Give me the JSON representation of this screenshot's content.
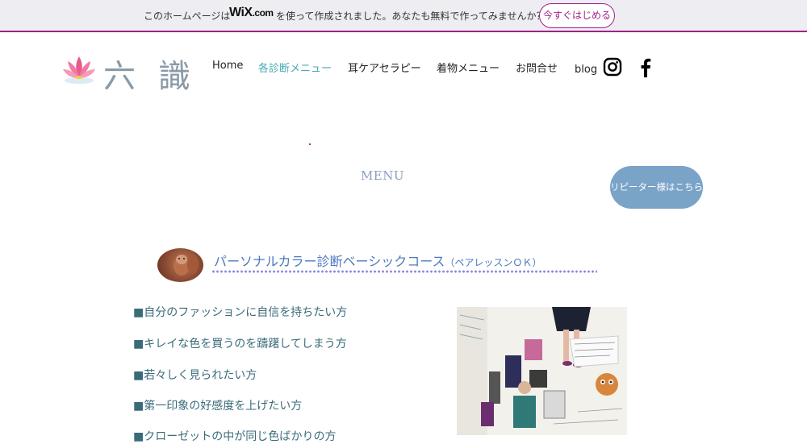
{
  "wix_banner": {
    "text_before": "このホームページは",
    "logo_main": "WiX",
    "logo_suffix": ".com",
    "text_after": "を使って作成されました。あなたも無料で作ってみませんか？",
    "cta_label": "今すぐはじめる",
    "accent_color": "#a0218c"
  },
  "header": {
    "logo_kanji": "六識",
    "nav": [
      {
        "label": "Home",
        "active": false
      },
      {
        "label": "各診断メニュー",
        "active": true
      },
      {
        "label": "耳ケアセラピー",
        "active": false
      },
      {
        "label": "着物メニュー",
        "active": false
      },
      {
        "label": "お問合せ",
        "active": false
      }
    ],
    "blog_label": "blog",
    "social_icons": [
      "instagram-icon",
      "facebook-icon"
    ]
  },
  "main": {
    "menu_title": "MENU",
    "repeater_button": "リピーター様はこちら",
    "course": {
      "title": "パーソナルカラー診断ベーシックコース",
      "subtitle": "（ペアレッスンＯＫ）"
    },
    "bullets": [
      "■自分のファッションに自信を持ちたい方",
      "■キレイな色を買うのを躊躇してしまう方",
      "■若々しく見られたい方",
      "■第一印象の好感度を上げたい方",
      "■クローゼットの中が同じ色ばかりの方"
    ]
  },
  "colors": {
    "nav_active": "#4aa9b5",
    "menu_title": "#8aa0bd",
    "repeater_button_bg": "#7aa3c8",
    "course_title": "#4b78c0",
    "bullet_text": "#3a6b7a"
  }
}
